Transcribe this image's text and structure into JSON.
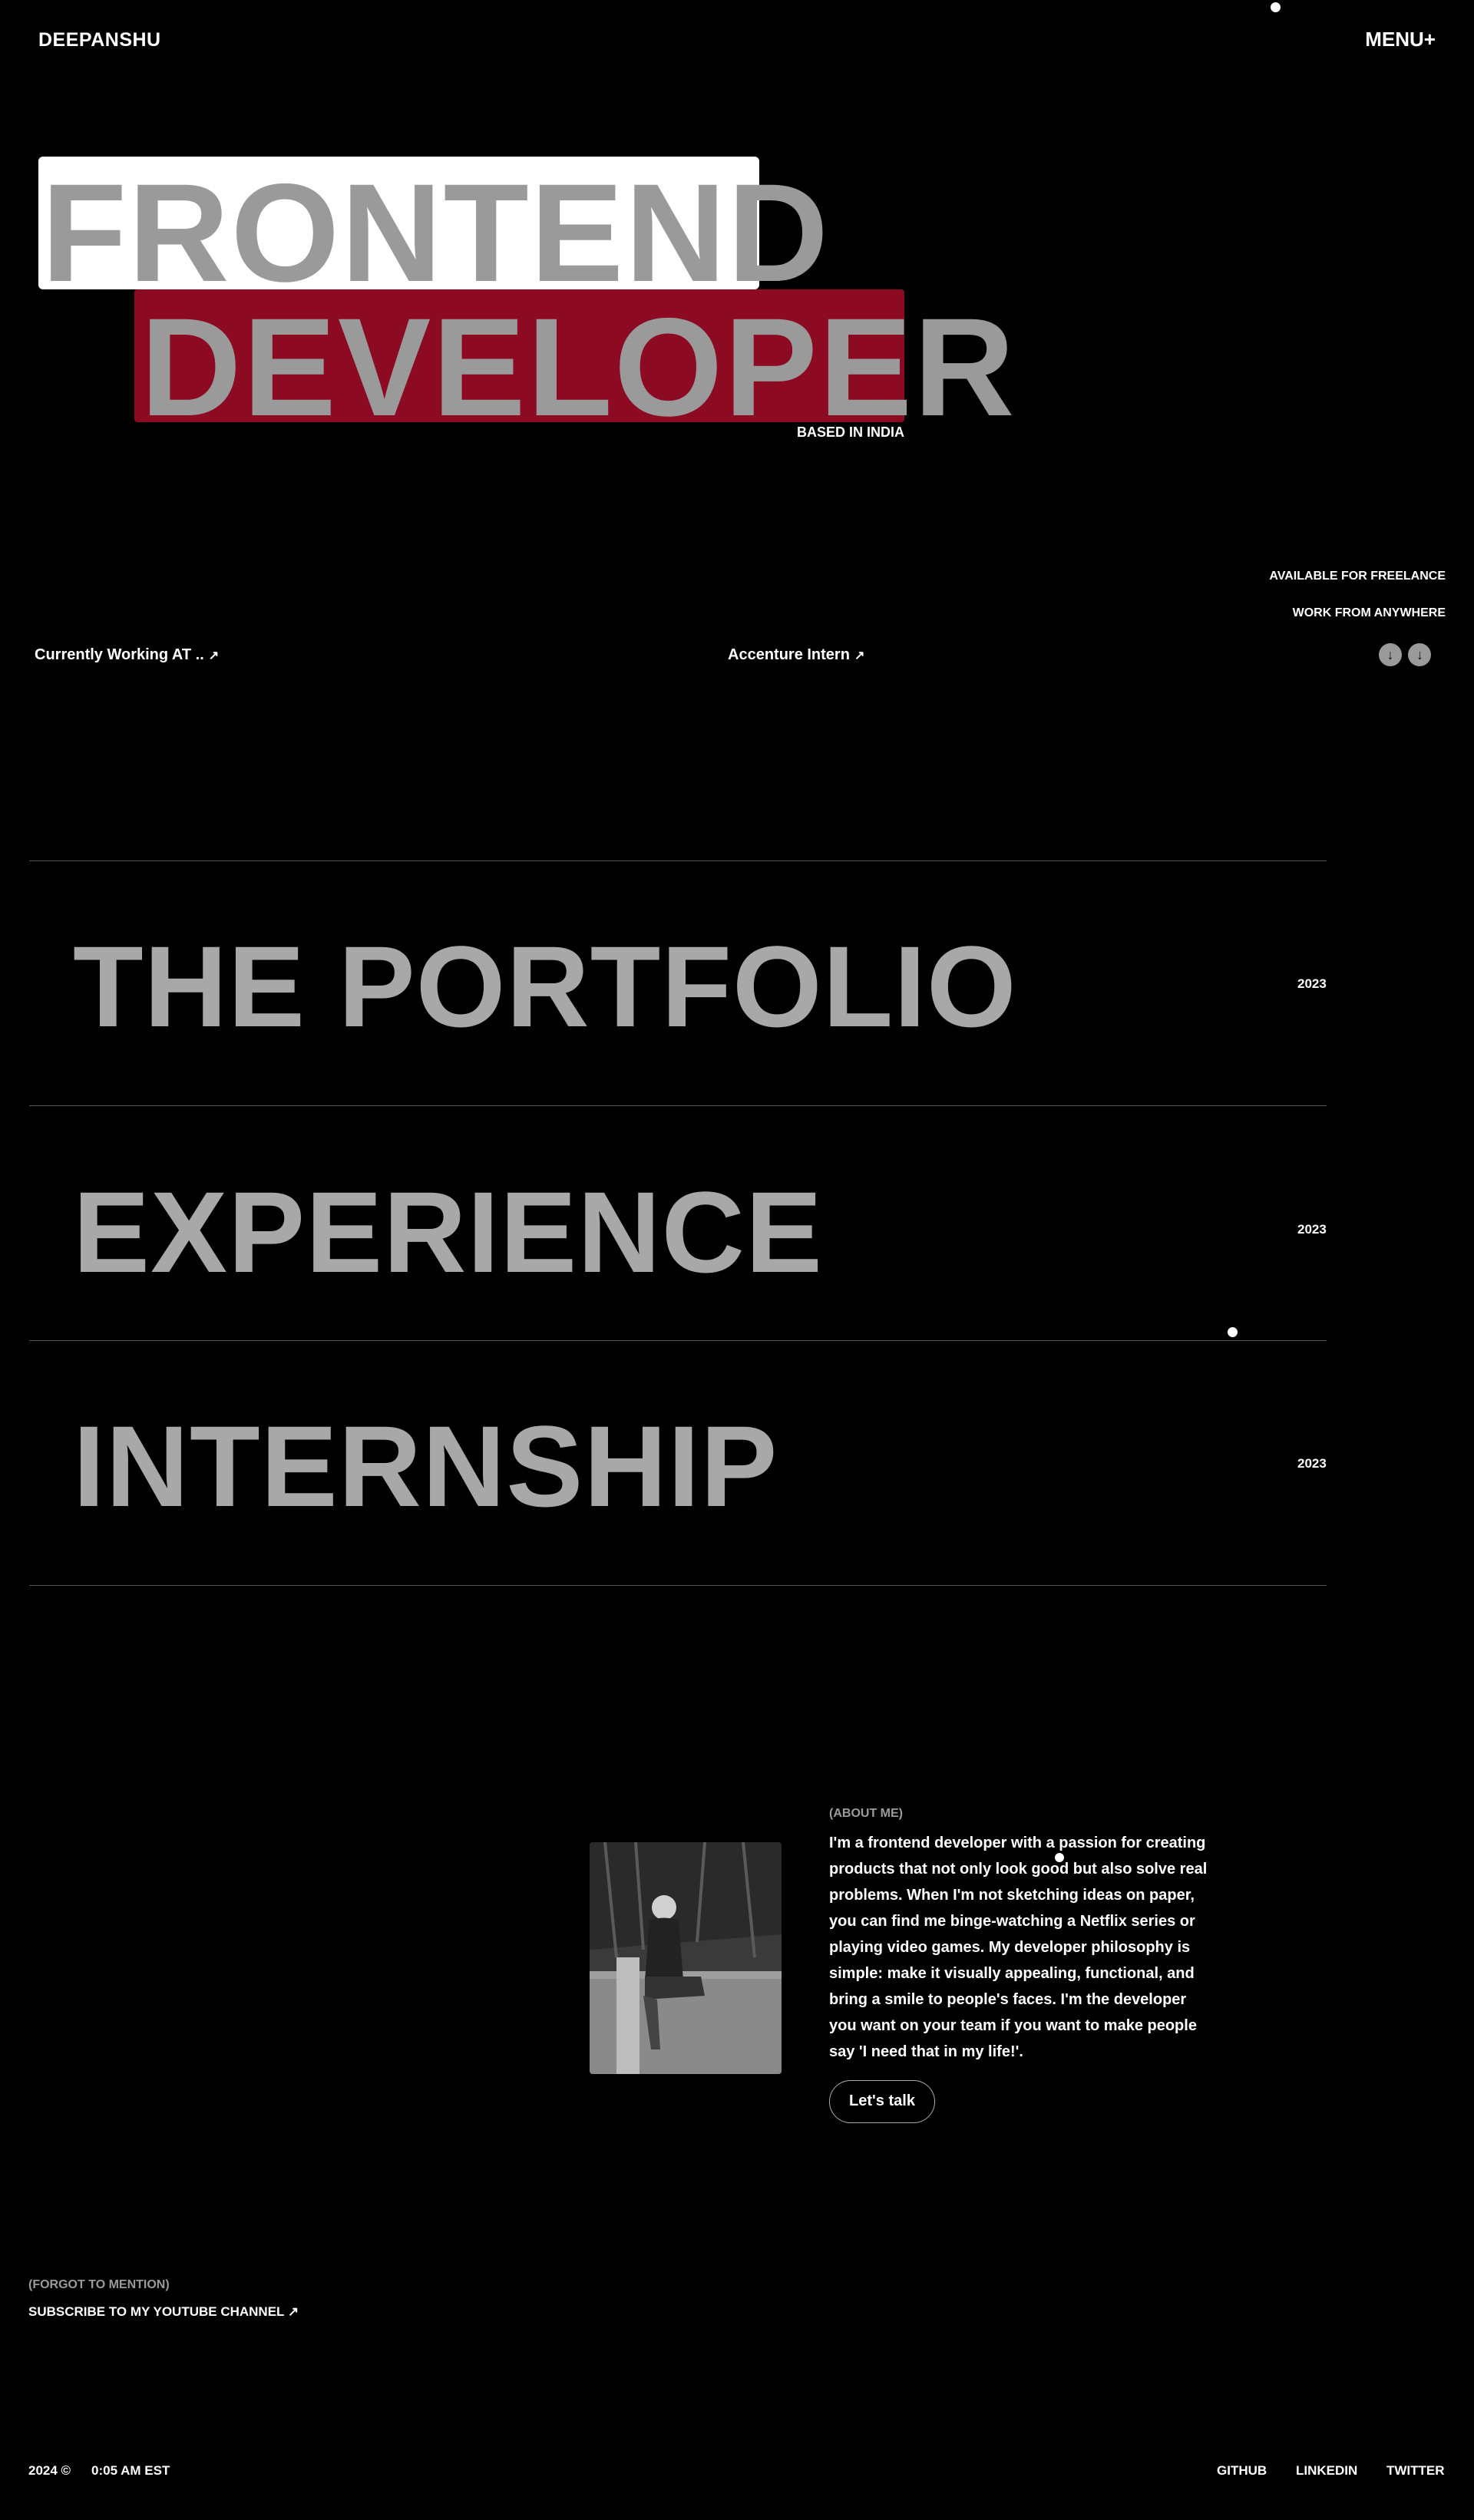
{
  "header": {
    "logo": "DEEPANSHU",
    "menu_label": "MENU+"
  },
  "hero": {
    "line1": "FRONTEND",
    "line2": "DEVELOPER",
    "location": "BASED IN INDIA"
  },
  "availability": {
    "freelance": "AVAILABLE FOR FREELANCE",
    "remote": "WORK FROM ANYWHERE"
  },
  "work": {
    "label": "Currently Working AT ..",
    "company": "Accenture Intern",
    "arrow": "↗"
  },
  "scroll_icons": {
    "down1": "↓",
    "down2": "↓"
  },
  "sections": [
    {
      "title": "THE PORTFOLIO",
      "year": "2023"
    },
    {
      "title": "EXPERIENCE",
      "year": "2023"
    },
    {
      "title": "INTERNSHIP",
      "year": "2023"
    }
  ],
  "about": {
    "label": "(ABOUT ME)",
    "text": "I'm a frontend developer with a passion for creating products that not only look good but also solve real problems. When I'm not sketching ideas on paper, you can find me binge-watching a Netflix series or playing video games. My developer philosophy is simple: make it visually appealing, functional, and bring a smile to people's faces. I'm the developer you want on your team if you want to make people say 'I need that in my life!'.",
    "button": "Let's talk"
  },
  "forgot": {
    "label": "(FORGOT TO MENTION)",
    "link": "SUBSCRIBE TO MY YOUTUBE CHANNEL",
    "arrow": "↗"
  },
  "footer": {
    "year": "2024 ©",
    "time": "0:05 AM EST",
    "links": [
      "GITHUB",
      "LINKEDIN",
      "TWITTER"
    ]
  }
}
